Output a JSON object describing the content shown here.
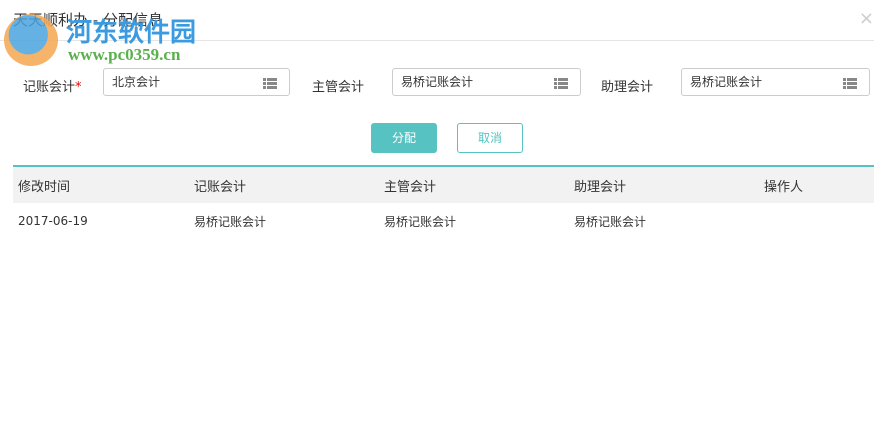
{
  "dialog": {
    "title": "天天顺利办 - 分配信息",
    "close": "×"
  },
  "watermark": {
    "name": "河东软件园",
    "url": "www.pc0359.cn"
  },
  "form": {
    "fields": [
      {
        "label": "记账会计",
        "required": "*",
        "value": "北京会计"
      },
      {
        "label": "主管会计",
        "value": "易桥记账会计"
      },
      {
        "label": "助理会计",
        "value": "易桥记账会计"
      }
    ],
    "ok": "分配",
    "cancel": "取消"
  },
  "table": {
    "headers": [
      "修改时间",
      "记账会计",
      "主管会计",
      "助理会计",
      "操作人"
    ],
    "rows": [
      [
        "2017-06-19",
        "易桥记账会计",
        "易桥记账会计",
        "易桥记账会计",
        ""
      ]
    ]
  }
}
